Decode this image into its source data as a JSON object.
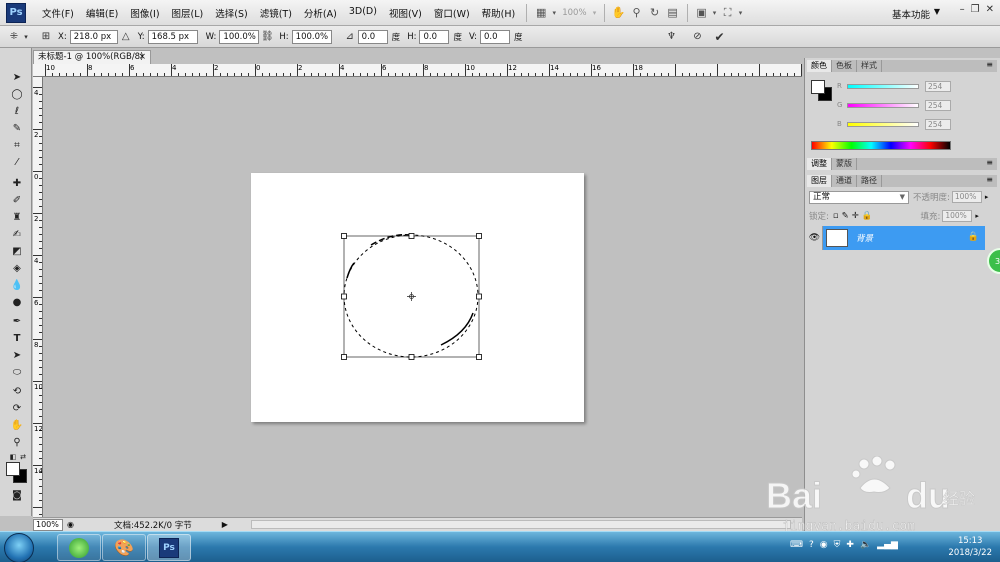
{
  "app": {
    "logo": "Ps",
    "menus": [
      "文件(F)",
      "编辑(E)",
      "图像(I)",
      "图层(L)",
      "选择(S)",
      "滤镜(T)",
      "分析(A)",
      "3D(D)",
      "视图(V)",
      "窗口(W)",
      "帮助(H)"
    ],
    "zoom_display": "100%",
    "workspace": "基本功能",
    "icons": {
      "mini_bridge": "bridge-icon",
      "hand": "hand-icon",
      "zoom": "zoom-icon",
      "rotate": "rotate-icon",
      "arrange": "arrange-icon",
      "screen_mode": "screen-mode-icon"
    }
  },
  "options": {
    "x_label": "X:",
    "x_value": "218.0 px",
    "y_label": "Y:",
    "y_value": "168.5 px",
    "w_label": "W:",
    "w_value": "100.0%",
    "h_label": "H:",
    "h_value": "100.0%",
    "angle_value": "0.0",
    "angle_unit": "度",
    "hskew_label": "H:",
    "hskew_value": "0.0",
    "hskew_unit": "度",
    "vskew_label": "V:",
    "vskew_value": "0.0",
    "vskew_unit": "度"
  },
  "document": {
    "tab_title": "未标题-1 @ 100%(RGB/8)",
    "tab_close": "×",
    "ruler_top_labels": [
      "10",
      "8",
      "6",
      "4",
      "2",
      "0",
      "2",
      "4",
      "6",
      "8",
      "10",
      "12",
      "14",
      "16",
      "18"
    ],
    "ruler_left_labels": [
      "4",
      "2",
      "0",
      "2",
      "4",
      "6",
      "8",
      "10",
      "12",
      "14"
    ]
  },
  "status": {
    "zoom": "100%",
    "doc_info": "文档:452.2K/0 字节",
    "arrow": "▶"
  },
  "panels": {
    "color_tabs": [
      "颜色",
      "色板",
      "样式"
    ],
    "color_channels": [
      {
        "label": "R",
        "value": "254"
      },
      {
        "label": "G",
        "value": "254"
      },
      {
        "label": "B",
        "value": "254"
      }
    ],
    "adjust_tabs": [
      "调整",
      "蒙版"
    ],
    "layer_tabs": [
      "图层",
      "通道",
      "路径"
    ],
    "blend_mode": "正常",
    "opacity_label": "不透明度:",
    "opacity_value": "100%",
    "lock_label": "锁定:",
    "fill_label": "填充:",
    "fill_value": "100%",
    "layer_name": "背景"
  },
  "taskbar": {
    "clock_time": "15:13",
    "clock_date": "2018/3/22",
    "ps_label": "Ps"
  },
  "badge": "33",
  "watermark": {
    "brand": "Bai",
    "brand2": "du",
    "brand_cn": "经验",
    "url": "jingyan.baidu.com"
  }
}
